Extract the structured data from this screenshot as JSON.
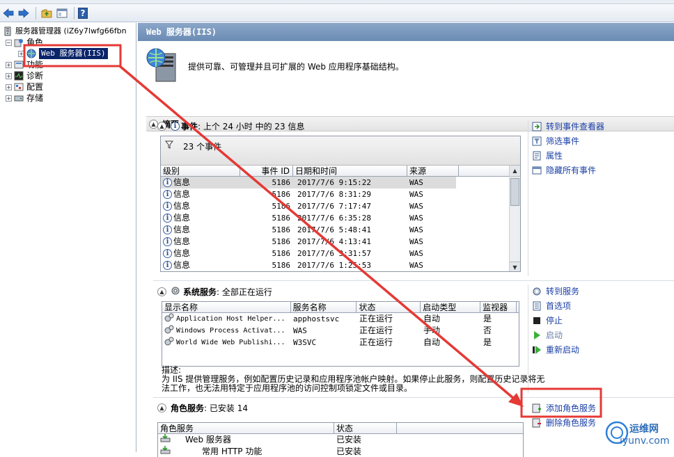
{
  "toolbar": {
    "back_icon": "back-arrow-icon",
    "forward_icon": "forward-arrow-icon",
    "up_icon": "folder-up-icon",
    "show_hide_icon": "console-tree-icon",
    "help_label": "?"
  },
  "tree": {
    "root": "服务器管理器 (iZ6y7lwfg66fbn",
    "roles": "角色",
    "web_server": "Web 服务器(IIS)",
    "features": "功能",
    "diagnostics": "诊断",
    "configuration": "配置",
    "storage": "存储"
  },
  "content": {
    "header_title": "Web 服务器(IIS)",
    "description": "提供可靠、可管理并且可扩展的 Web 应用程序基础结构。",
    "summary_label": "摘要"
  },
  "events": {
    "title_bold": "事件",
    "title_rest": ": 上个 24 小时 中的 23 信息",
    "filter_text": "23 个事件",
    "columns": [
      "级别",
      "事件 ID",
      "日期和时间",
      "来源"
    ],
    "rows": [
      {
        "level": "信息",
        "id": "5186",
        "datetime": "2017/7/6 9:15:22",
        "source": "WAS"
      },
      {
        "level": "信息",
        "id": "5186",
        "datetime": "2017/7/6 8:31:29",
        "source": "WAS"
      },
      {
        "level": "信息",
        "id": "5186",
        "datetime": "2017/7/6 7:17:47",
        "source": "WAS"
      },
      {
        "level": "信息",
        "id": "5186",
        "datetime": "2017/7/6 6:35:28",
        "source": "WAS"
      },
      {
        "level": "信息",
        "id": "5186",
        "datetime": "2017/7/6 5:48:41",
        "source": "WAS"
      },
      {
        "level": "信息",
        "id": "5186",
        "datetime": "2017/7/6 4:13:41",
        "source": "WAS"
      },
      {
        "level": "信息",
        "id": "5186",
        "datetime": "2017/7/6 3:31:57",
        "source": "WAS"
      },
      {
        "level": "信息",
        "id": "5186",
        "datetime": "2017/7/6 1:25:53",
        "source": "WAS"
      }
    ],
    "actions": [
      "转到事件查看器",
      "筛选事件",
      "属性",
      "隐藏所有事件"
    ]
  },
  "services": {
    "title_bold": "系统服务",
    "title_rest": ": 全部正在运行",
    "columns": [
      "显示名称",
      "服务名称",
      "状态",
      "启动类型",
      "监视器"
    ],
    "rows": [
      {
        "display": "Application Host Helper...",
        "name": "apphostsvc",
        "status": "正在运行",
        "startup": "自动",
        "monitor": "是"
      },
      {
        "display": "Windows Process Activat...",
        "name": "WAS",
        "status": "正在运行",
        "startup": "手动",
        "monitor": "否"
      },
      {
        "display": "World Wide Web Publishi...",
        "name": "W3SVC",
        "status": "正在运行",
        "startup": "自动",
        "monitor": "是"
      }
    ],
    "description_label": "描述:",
    "description": "为 IIS 提供管理服务，例如配置历史记录和应用程序池帐户映射。如果停止此服务，则配置历史记录将无法工作，也无法用特定于应用程序池的访问控制项锁定文件或目录。",
    "actions": [
      "转到服务",
      "首选项",
      "停止",
      "启动",
      "重新启动"
    ]
  },
  "role_services": {
    "title_bold": "角色服务",
    "title_rest": ": 已安装 14",
    "columns": [
      "角色服务",
      "状态"
    ],
    "rows": [
      {
        "name": "Web 服务器",
        "status": "已安装"
      },
      {
        "name": "常用 HTTP 功能",
        "status": "已安装"
      }
    ],
    "actions": [
      "添加角色服务",
      "删除角色服务"
    ]
  },
  "watermark": {
    "text": "运维网",
    "url": "iyunv.com"
  },
  "colors": {
    "link": "#1a3fa6",
    "header": "#6c8cb4",
    "highlight_box": "#e53935"
  }
}
